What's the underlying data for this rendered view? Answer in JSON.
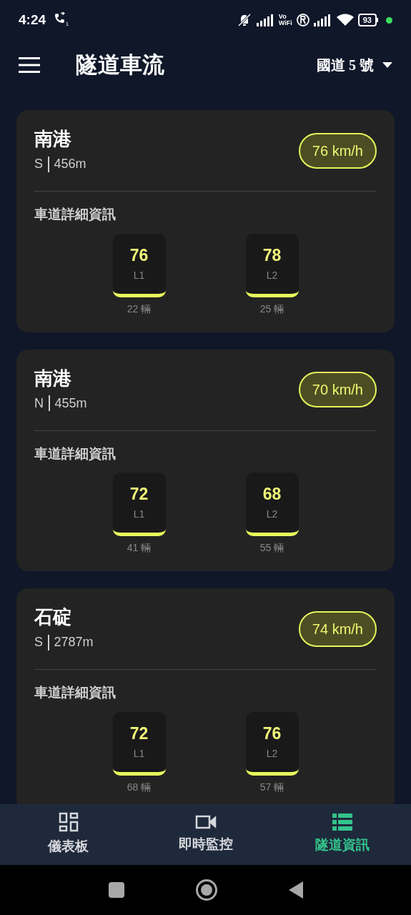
{
  "status_bar": {
    "time": "4:24",
    "call_badge": "1",
    "wifi_calling": [
      "Vo",
      "WiFi"
    ],
    "battery": "93"
  },
  "header": {
    "title": "隧道車流",
    "route": "國道 5 號"
  },
  "tunnels": [
    {
      "name": "南港",
      "direction": "S",
      "length": "456m",
      "speed": "76 km/h",
      "section_label": "車道詳細資訊",
      "lanes": [
        {
          "speed": "76",
          "lane": "L1",
          "count": "22 輛"
        },
        {
          "speed": "78",
          "lane": "L2",
          "count": "25 輛"
        }
      ]
    },
    {
      "name": "南港",
      "direction": "N",
      "length": "455m",
      "speed": "70 km/h",
      "section_label": "車道詳細資訊",
      "lanes": [
        {
          "speed": "72",
          "lane": "L1",
          "count": "41 輛"
        },
        {
          "speed": "68",
          "lane": "L2",
          "count": "55 輛"
        }
      ]
    },
    {
      "name": "石碇",
      "direction": "S",
      "length": "2787m",
      "speed": "74 km/h",
      "section_label": "車道詳細資訊",
      "lanes": [
        {
          "speed": "72",
          "lane": "L1",
          "count": "68 輛"
        },
        {
          "speed": "76",
          "lane": "L2",
          "count": "57 輛"
        }
      ]
    }
  ],
  "bottom_nav": [
    {
      "kind": "dashboard",
      "label": "儀表板",
      "selected": false
    },
    {
      "kind": "camera",
      "label": "即時監控",
      "selected": false
    },
    {
      "kind": "list",
      "label": "隧道資訊",
      "selected": true
    }
  ]
}
